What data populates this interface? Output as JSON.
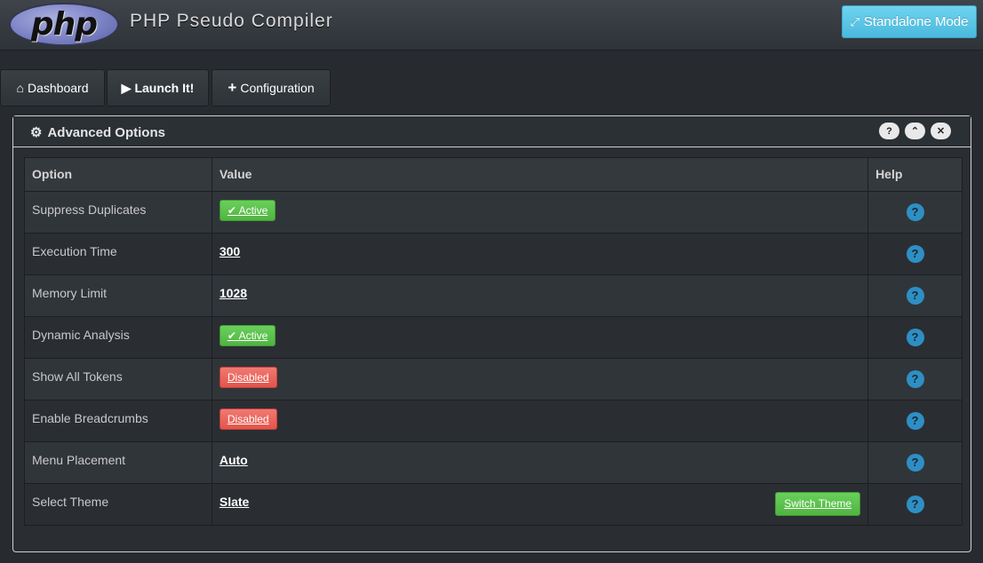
{
  "header": {
    "logo_text": "php",
    "title": "PHP Pseudo Compiler",
    "standalone_label": "Standalone Mode"
  },
  "tabs": [
    {
      "label": "Dashboard",
      "icon": "home-icon"
    },
    {
      "label": "Launch It!",
      "icon": "play-icon"
    },
    {
      "label": "Configuration",
      "icon": "plus-icon"
    }
  ],
  "panel": {
    "title": "Advanced Options",
    "icon": "gear-icon",
    "controls": [
      "help-icon",
      "collapse-icon",
      "close-icon"
    ]
  },
  "table": {
    "headers": [
      "Option",
      "Value",
      "Help"
    ],
    "rows": [
      {
        "option": "Suppress Duplicates",
        "value": "Active",
        "type": "active"
      },
      {
        "option": "Execution Time",
        "value": "300",
        "type": "link"
      },
      {
        "option": "Memory Limit",
        "value": "1028",
        "type": "link"
      },
      {
        "option": "Dynamic Analysis",
        "value": "Active",
        "type": "active"
      },
      {
        "option": "Show All Tokens",
        "value": "Disabled",
        "type": "disabled"
      },
      {
        "option": "Enable Breadcrumbs",
        "value": "Disabled",
        "type": "disabled"
      },
      {
        "option": "Menu Placement",
        "value": "Auto",
        "type": "link"
      },
      {
        "option": "Select Theme",
        "value": "Slate",
        "type": "link",
        "action": "Switch Theme"
      }
    ]
  },
  "colors": {
    "accent": "#5bc0de",
    "success": "#62c462",
    "danger": "#ee5f5b",
    "help": "#2e8fc4"
  }
}
